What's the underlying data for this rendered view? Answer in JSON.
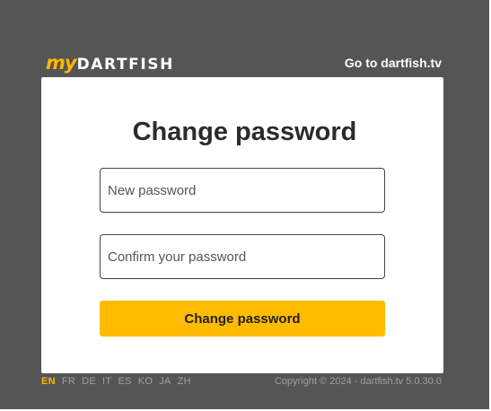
{
  "header": {
    "logo_my": "my",
    "logo_brand": "DARTFISH",
    "site_link": "Go to dartfish.tv"
  },
  "form": {
    "title": "Change password",
    "new_password_placeholder": "New password",
    "confirm_password_placeholder": "Confirm your password",
    "submit_label": "Change password"
  },
  "footer": {
    "languages": [
      "EN",
      "FR",
      "DE",
      "IT",
      "ES",
      "KO",
      "JA",
      "ZH"
    ],
    "active_language": "EN",
    "copyright": "Copyright © 2024 - dartfish.tv 5.0.30.0"
  },
  "colors": {
    "background": "#555555",
    "accent": "#ffbb00",
    "card": "#ffffff",
    "muted_text": "#a0a0a0"
  }
}
